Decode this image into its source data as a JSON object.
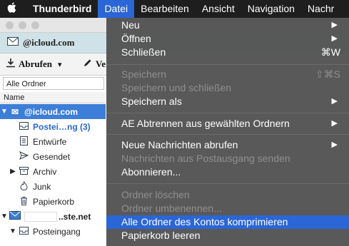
{
  "menubar": {
    "apple_icon": "apple-logo-icon",
    "items": [
      "Thunderbird",
      "Datei",
      "Bearbeiten",
      "Ansicht",
      "Navigation",
      "Nachr"
    ]
  },
  "tab": {
    "label": "@icloud.com"
  },
  "toolbar": {
    "fetch_label": "Abrufen",
    "write_label": "Ve"
  },
  "folder_filter": {
    "value": "Alle Ordner"
  },
  "folder_header": {
    "name": "Name"
  },
  "folders": {
    "account1": "@icloud.com",
    "inbox": "Postei…ng (3)",
    "drafts": "Entwürfe",
    "sent": "Gesendet",
    "archive": "Archiv",
    "junk": "Junk",
    "trash": "Papierkorb",
    "account2": "..ste.net",
    "inbox2": "Posteingang"
  },
  "menu": {
    "neu": "Neu",
    "oeffnen": "Öffnen",
    "schliessen": "Schließen",
    "schliessen_sc": "⌘W",
    "speichern": "Speichern",
    "speichern_sc": "⇧⌘S",
    "speichern_schliessen": "Speichern und schließen",
    "speichern_als": "Speichern als",
    "ae": "AE Abtrennen aus gewählten Ordnern",
    "neue_nachrichten": "Neue Nachrichten abrufen",
    "postausgang": "Nachrichten aus Postausgang senden",
    "abonnieren": "Abonnieren...",
    "ordner_loeschen": "Ordner löschen",
    "ordner_umbenennen": "Ordner umbenennen...",
    "komprimieren": "Alle Ordner des Kontos komprimieren",
    "papierkorb_leeren": "Papierkorb leeren",
    "submenu_arrow": "▶"
  }
}
